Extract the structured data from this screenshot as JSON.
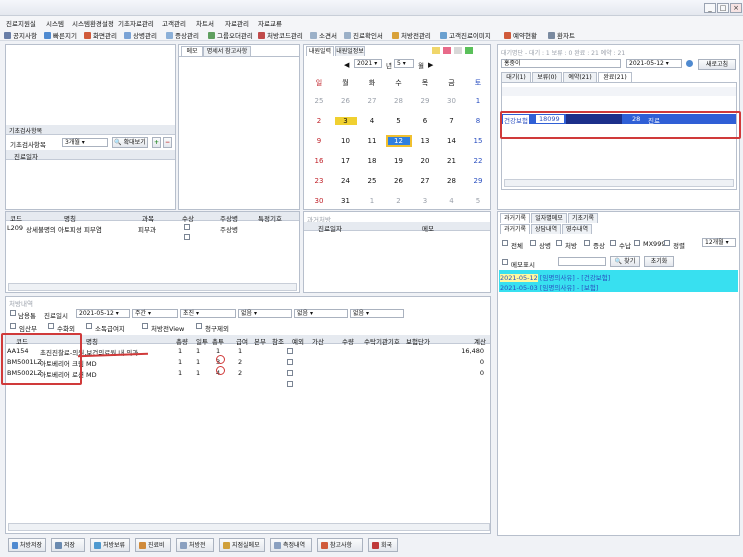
{
  "menu": [
    "진료지원실",
    "시스템",
    "시스템환경설정",
    "기초자료관리",
    "고객관리",
    "차트서",
    "자료관리",
    "자료교류"
  ],
  "toolbar": [
    "공지사항",
    "빠른지기",
    "화면관리",
    "상병관리",
    "증상관리",
    "그룹오더관리",
    "처방코드관리",
    "소견서",
    "진료확인서",
    "처방전관리",
    "고객진료이미지",
    "예약현황",
    "환자트"
  ],
  "left_top": {
    "section": "기초검사항목",
    "period_label": "기초검사항목",
    "period_value": "3개월",
    "zoom_button": "확대보기",
    "date_col": "진료일자"
  },
  "memo_tabs": [
    "메모",
    "명세서 참고사항"
  ],
  "calendar": {
    "tabs": [
      "내원일력",
      "내원일정보"
    ],
    "year": "2021",
    "month": "5",
    "year_suffix": "년",
    "month_suffix": "월",
    "weekdays": [
      "일",
      "월",
      "화",
      "수",
      "목",
      "금",
      "토"
    ],
    "weeks": [
      [
        "25",
        "26",
        "27",
        "28",
        "29",
        "30",
        "1"
      ],
      [
        "2",
        "3",
        "4",
        "5",
        "6",
        "7",
        "8"
      ],
      [
        "9",
        "10",
        "11",
        "12",
        "13",
        "14",
        "15"
      ],
      [
        "16",
        "17",
        "18",
        "19",
        "20",
        "21",
        "22"
      ],
      [
        "23",
        "24",
        "25",
        "26",
        "27",
        "28",
        "29"
      ],
      [
        "30",
        "31",
        "1",
        "2",
        "3",
        "4",
        "5"
      ]
    ],
    "selected": "12"
  },
  "right_top": {
    "header": "대기명단 - 대기 : 1 보류 : 0 완료 : 21 예약 : 21",
    "name_value": "홍중이",
    "date": "2021-05-12",
    "new_button": "새로고침",
    "tabs": [
      "대기(1)",
      "보류(0)",
      "예약(21)",
      "완료(21)"
    ],
    "rows": [
      {
        "type": "건강보험",
        "chart": "18099",
        "age": "28",
        "status": "진료"
      }
    ]
  },
  "diag_header": {
    "cols": [
      "코드",
      "명칭",
      "과목",
      "수상",
      "주상병",
      "특정기호"
    ]
  },
  "diag_rows": [
    {
      "code": "L209",
      "name": "상세불명의 아토피성 피부염",
      "dept": "피부과",
      "main": "주상병"
    }
  ],
  "past_header": {
    "title": "과거처방",
    "cols": [
      "진료일자",
      "메모"
    ]
  },
  "history": {
    "tabs": [
      "과거기록",
      "일자별메모",
      "기초기록"
    ],
    "subtabs": [
      "과거기록",
      "상담내역",
      "영수내역"
    ],
    "filters": [
      "전체",
      "상병",
      "처방",
      "증상",
      "수납",
      "MX999",
      "정렬"
    ],
    "period": "12개월",
    "memo_label": "메모표시",
    "search_button": "찾기",
    "reset_button": "초기화",
    "entries": [
      {
        "date": "2021-05-12",
        "text": "[임명의사유] - [건강보험]"
      },
      {
        "date": "2021-05-03",
        "text": "[임명의사유] - [보험]"
      }
    ]
  },
  "rx": {
    "header": "처방내역",
    "row1": {
      "label1": "남용통",
      "date_label": "진료일시",
      "date": "2021-05-12",
      "opt1": "주간",
      "opt2": "초진",
      "opt3": "없음",
      "opt4": "없음",
      "opt5": "없음"
    },
    "row2": [
      "임산부",
      "수화외",
      "소독급여지",
      "처방전View",
      "청구제외"
    ],
    "cols": [
      "코드",
      "명칭",
      "총량",
      "일투",
      "총투",
      "급여",
      "본부",
      "참조",
      "예외",
      "가산",
      "수량",
      "수탁기관기호",
      "보험단가",
      "계산"
    ],
    "items": [
      {
        "code": "AA154",
        "name": "초진진찰료-의원,보건의료원 내 의과",
        "total": "1",
        "daily": "1",
        "days": "1",
        "pay": "1",
        "price": "16,480"
      },
      {
        "code": "BM5001LZ",
        "name": "아토베리어 크림 MD",
        "total": "1",
        "daily": "1",
        "days": "3",
        "pay": "2",
        "price": "0"
      },
      {
        "code": "BM5002LZ",
        "name": "아토베리어 로션 MD",
        "total": "1",
        "daily": "1",
        "days": "4",
        "pay": "2",
        "price": "0"
      }
    ]
  },
  "bottom_buttons": [
    "처방저장",
    "저장",
    "처방보류",
    "진료비",
    "처방전",
    "지점실메모",
    "측정내역",
    "참고사항",
    "회국"
  ]
}
